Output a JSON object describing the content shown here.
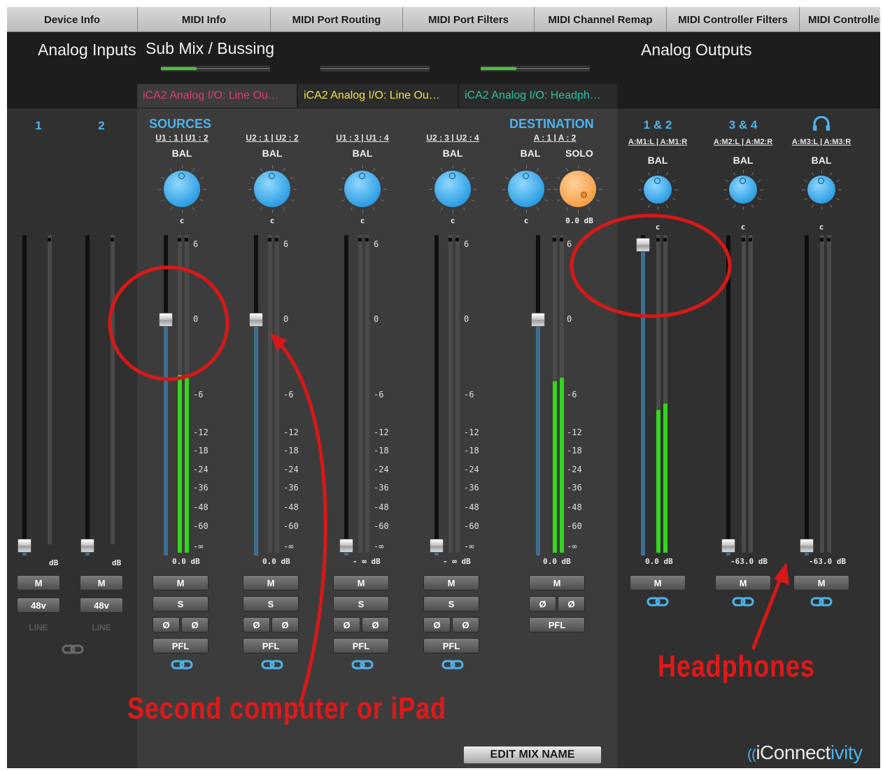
{
  "top_tabs": [
    "Device Info",
    "MIDI Info",
    "MIDI Port Routing",
    "MIDI Port Filters",
    "MIDI Channel Remap",
    "MIDI Controller Filters",
    "MIDI Controller"
  ],
  "headers": {
    "analog_inputs": "Analog Inputs",
    "sub_mix": "Sub Mix / Bussing",
    "analog_outputs": "Analog Outputs"
  },
  "mix_tabs": [
    {
      "label": "iCA2 Analog I/O: Line Ou…",
      "color": "#e0397c"
    },
    {
      "label": "iCA2 Analog I/O: Line Ou…",
      "color": "#f0e63c"
    },
    {
      "label": "iCA2 Analog I/O: Headph…",
      "color": "#2ec1a3"
    }
  ],
  "bus_levels": [
    0.33,
    0,
    0.33
  ],
  "inputs": [
    {
      "num": "1",
      "db": "dB",
      "level": 0,
      "meter": 0,
      "mute": "M",
      "phantom": "48v",
      "mode": "LINE"
    },
    {
      "num": "2",
      "db": "dB",
      "level": 0,
      "meter": 0,
      "mute": "M",
      "phantom": "48v",
      "mode": "LINE"
    }
  ],
  "sources_label": "SOURCES",
  "destination_label": "DESTINATION",
  "mix_strips": [
    {
      "route": "U1 : 1 | U1 : 2",
      "bal_label": "BAL",
      "bal_value": "c",
      "db": "0.0  dB",
      "fader_db": 0,
      "meter": [
        0.56,
        0.56
      ],
      "mute": "M",
      "solo": "S",
      "phase": [
        "Ø",
        "Ø"
      ],
      "pfl": "PFL"
    },
    {
      "route": "U2 : 1 | U2 : 2",
      "bal_label": "BAL",
      "bal_value": "c",
      "db": "0.0  dB",
      "fader_db": 0,
      "meter": [
        0,
        0
      ],
      "mute": "M",
      "solo": "S",
      "phase": [
        "Ø",
        "Ø"
      ],
      "pfl": "PFL"
    },
    {
      "route": "U1 : 3 | U1 : 4",
      "bal_label": "BAL",
      "bal_value": "c",
      "db": "- ∞   dB",
      "fader_db": "-∞",
      "meter": [
        0,
        0
      ],
      "mute": "M",
      "solo": "S",
      "phase": [
        "Ø",
        "Ø"
      ],
      "pfl": "PFL"
    },
    {
      "route": "U2 : 3 | U2 : 4",
      "bal_label": "BAL",
      "bal_value": "c",
      "db": "- ∞   dB",
      "fader_db": "-∞",
      "meter": [
        0,
        0
      ],
      "mute": "M",
      "solo": "S",
      "phase": [
        "Ø",
        "Ø"
      ],
      "pfl": "PFL"
    }
  ],
  "destination": {
    "route": "A : 1 | A : 2",
    "bal_label": "BAL",
    "bal_value": "c",
    "solo_label": "SOLO",
    "solo_value": "0.0  dB",
    "db": "0.0  dB",
    "fader_db": 0,
    "meter": [
      0.54,
      0.55
    ],
    "mute": "M",
    "phase": [
      "Ø",
      "Ø"
    ],
    "pfl": "PFL"
  },
  "scale": [
    "6",
    "0",
    "-6",
    "-12",
    "-18",
    "-24",
    "-36",
    "-48",
    "-60",
    "-∞"
  ],
  "outputs": [
    {
      "num": "1 & 2",
      "route": "A:M1:L | A:M1:R",
      "bal_label": "BAL",
      "bal_value": "c",
      "db": "0.0  dB",
      "fader_db": 6,
      "meter": [
        0.45,
        0.47
      ],
      "mute": "M"
    },
    {
      "num": "3 & 4",
      "route": "A:M2:L | A:M2:R",
      "bal_label": "BAL",
      "bal_value": "c",
      "db": "-63.0  dB",
      "fader_db": -63,
      "meter": [
        0,
        0
      ],
      "mute": "M"
    },
    {
      "num": "",
      "icon": "headphones-icon",
      "route": "A:M3:L | A:M3:R",
      "bal_label": "BAL",
      "bal_value": "c",
      "db": "-63.0  dB",
      "fader_db": -63,
      "meter": [
        0,
        0
      ],
      "mute": "M"
    }
  ],
  "edit_mix_name": "EDIT MIX NAME",
  "logo": {
    "pre": "iConnect",
    "accent": "ivity"
  },
  "annotations": {
    "second": "Second computer or iPad",
    "headphones": "Headphones"
  },
  "colors": {
    "accent_blue": "#4db3ea",
    "meter_green": "#34d41f",
    "annotation_red": "#e01919",
    "knob_orange": "#f5a04a"
  }
}
